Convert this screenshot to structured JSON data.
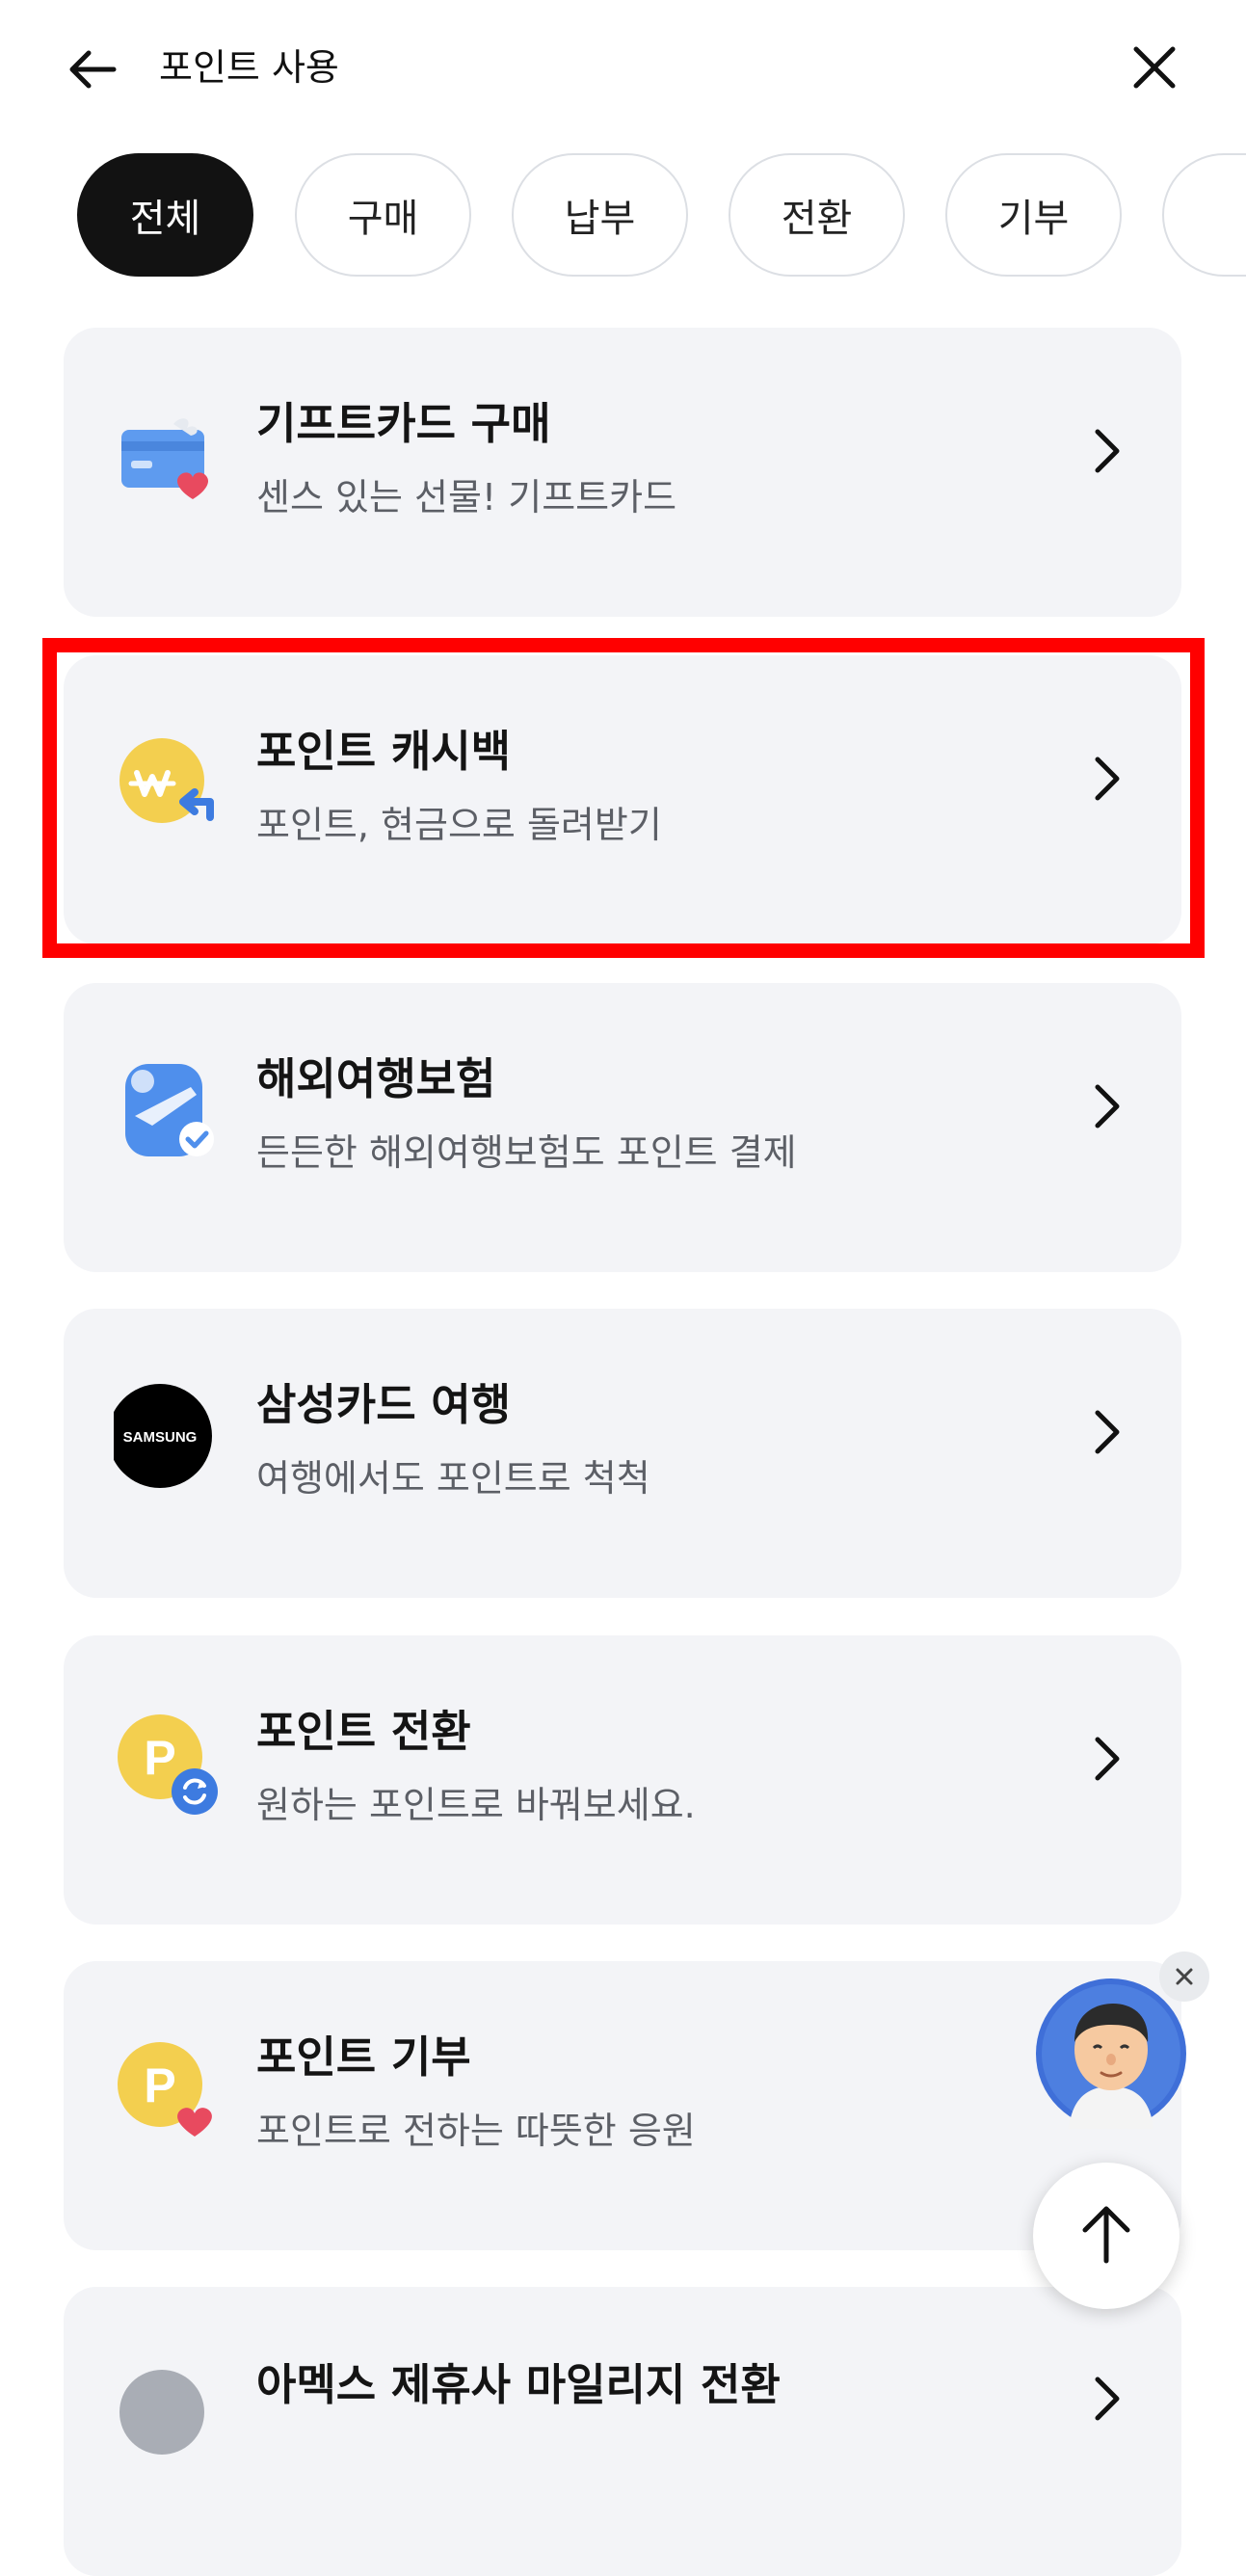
{
  "header": {
    "title": "포인트 사용",
    "back_icon": "arrow-left-icon",
    "close_icon": "close-icon"
  },
  "chips": [
    {
      "label": "전체",
      "active": true
    },
    {
      "label": "구매",
      "active": false
    },
    {
      "label": "납부",
      "active": false
    },
    {
      "label": "전환",
      "active": false
    },
    {
      "label": "기부",
      "active": false
    }
  ],
  "cards": [
    {
      "title": "기프트카드 구매",
      "subtitle": "센스 있는 선물! 기프트카드",
      "icon": "gift-card-icon"
    },
    {
      "title": "포인트 캐시백",
      "subtitle": "포인트, 현금으로 돌려받기",
      "icon": "won-cashback-icon"
    },
    {
      "title": "해외여행보험",
      "subtitle": "든든한 해외여행보험도 포인트 결제",
      "icon": "travel-insurance-icon"
    },
    {
      "title": "삼성카드 여행",
      "subtitle": "여행에서도 포인트로 척척",
      "icon": "samsung-logo-icon",
      "logo_text": "SAMSUNG"
    },
    {
      "title": "포인트 전환",
      "subtitle": "원하는 포인트로 바꿔보세요.",
      "icon": "point-exchange-icon"
    },
    {
      "title": "포인트 기부",
      "subtitle": "포인트로 전하는 따뜻한 응원",
      "icon": "point-donate-icon"
    },
    {
      "title": "아멕스 제휴사 마일리지 전환",
      "subtitle": "",
      "icon": "mileage-icon"
    }
  ],
  "highlighted_card_index": 1,
  "floating": {
    "avatar_icon": "assistant-avatar-icon",
    "close_icon": "close-icon",
    "scroll_top_icon": "arrow-up-icon"
  },
  "colors": {
    "card_bg": "#f3f4f7",
    "chip_active_bg": "#121212",
    "highlight": "#ff0000",
    "coin_yellow": "#f3cf4f",
    "accent_blue": "#3d7be0"
  }
}
